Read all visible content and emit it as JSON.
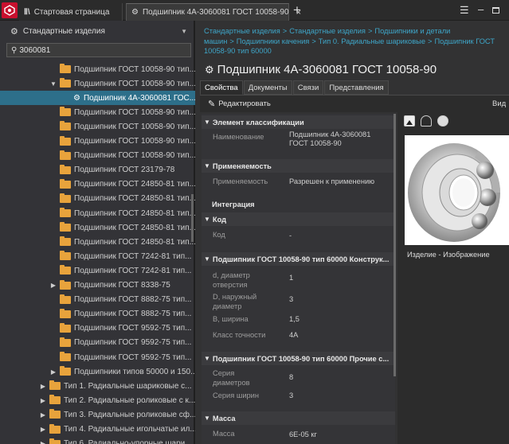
{
  "titlebar": {
    "tab_start": "Стартовая страница",
    "tab_part": "Подшипник 4А-3060081 ГОСТ 10058-90",
    "close_symbol": "×",
    "add_symbol": "+",
    "menu_symbol": "☰",
    "minimize_symbol": "–"
  },
  "left_panel": {
    "title": "Стандартные изделия",
    "search_value": "3060081",
    "tree": [
      {
        "label": "Подшипник ГОСТ 10058-90 тип...",
        "level": 1,
        "folder": true,
        "arrow": ""
      },
      {
        "label": "Подшипник ГОСТ 10058-90 тип...",
        "level": 1,
        "folder": true,
        "arrow": "▼"
      },
      {
        "label": "Подшипник 4А-3060081 ГОС...",
        "level": 2,
        "folder": false,
        "arrow": "",
        "selected": true
      },
      {
        "label": "Подшипник ГОСТ 10058-90 тип...",
        "level": 1,
        "folder": true,
        "arrow": ""
      },
      {
        "label": "Подшипник ГОСТ 10058-90 тип...",
        "level": 1,
        "folder": true,
        "arrow": ""
      },
      {
        "label": "Подшипник ГОСТ 10058-90 тип...",
        "level": 1,
        "folder": true,
        "arrow": ""
      },
      {
        "label": "Подшипник ГОСТ 10058-90 тип...",
        "level": 1,
        "folder": true,
        "arrow": ""
      },
      {
        "label": "Подшипник ГОСТ 23179-78",
        "level": 1,
        "folder": true,
        "arrow": ""
      },
      {
        "label": "Подшипник ГОСТ 24850-81 тип...",
        "level": 1,
        "folder": true,
        "arrow": ""
      },
      {
        "label": "Подшипник ГОСТ 24850-81 тип...",
        "level": 1,
        "folder": true,
        "arrow": ""
      },
      {
        "label": "Подшипник ГОСТ 24850-81 тип...",
        "level": 1,
        "folder": true,
        "arrow": ""
      },
      {
        "label": "Подшипник ГОСТ 24850-81 тип...",
        "level": 1,
        "folder": true,
        "arrow": ""
      },
      {
        "label": "Подшипник ГОСТ 24850-81 тип...",
        "level": 1,
        "folder": true,
        "arrow": ""
      },
      {
        "label": "Подшипник ГОСТ 7242-81 тип...",
        "level": 1,
        "folder": true,
        "arrow": ""
      },
      {
        "label": "Подшипник ГОСТ 7242-81 тип...",
        "level": 1,
        "folder": true,
        "arrow": ""
      },
      {
        "label": "Подшипник ГОСТ 8338-75",
        "level": 1,
        "folder": true,
        "arrow": "▶"
      },
      {
        "label": "Подшипник ГОСТ 8882-75 тип...",
        "level": 1,
        "folder": true,
        "arrow": ""
      },
      {
        "label": "Подшипник ГОСТ 8882-75 тип...",
        "level": 1,
        "folder": true,
        "arrow": ""
      },
      {
        "label": "Подшипник ГОСТ 9592-75 тип...",
        "level": 1,
        "folder": true,
        "arrow": ""
      },
      {
        "label": "Подшипник ГОСТ 9592-75 тип...",
        "level": 1,
        "folder": true,
        "arrow": ""
      },
      {
        "label": "Подшипник ГОСТ 9592-75 тип...",
        "level": 1,
        "folder": true,
        "arrow": ""
      },
      {
        "label": "Подшипники типов 50000 и 150...",
        "level": 1,
        "folder": true,
        "arrow": "▶"
      },
      {
        "label": "Тип 1. Радиальные шариковые с...",
        "level": 0,
        "folder": true,
        "arrow": "▶"
      },
      {
        "label": "Тип 2. Радиальные роликовые с к...",
        "level": 0,
        "folder": true,
        "arrow": "▶"
      },
      {
        "label": "Тип 3. Радиальные роликовые сф...",
        "level": 0,
        "folder": true,
        "arrow": "▶"
      },
      {
        "label": "Тип 4. Радиальные игольчатые ил...",
        "level": 0,
        "folder": true,
        "arrow": "▶"
      },
      {
        "label": "Тип 6. Радиально-упорные шари...",
        "level": 0,
        "folder": true,
        "arrow": "▶"
      }
    ]
  },
  "breadcrumb": {
    "items": [
      "Стандартные изделия",
      "Стандартные изделия",
      "Подшипники и детали машин",
      "Подшипники качения",
      "Тип 0. Радиальные шариковые",
      "Подшипник ГОСТ 10058-90 тип 60000"
    ],
    "separator": ">"
  },
  "part": {
    "title": "Подшипник 4А-3060081 ГОСТ 10058-90"
  },
  "tabs": [
    "Свойства",
    "Документы",
    "Связи",
    "Представления"
  ],
  "toolbar": {
    "edit_label": "Редактировать",
    "view_label": "Вид"
  },
  "properties": {
    "sec_classification": "Элемент классификации",
    "name_label": "Наименование",
    "name_value": "Подшипник 4А-3060081 ГОСТ 10058-90",
    "sec_applicability": "Применяемость",
    "applicability_label": "Применяемость",
    "applicability_value": "Разрешен к применению",
    "integration_label": "Интеграция",
    "sec_code": "Код",
    "code_label": "Код",
    "code_value": "-",
    "sec_design": "Подшипник ГОСТ 10058-90 тип 60000 Конструк...",
    "d_label": "d, диаметр отверстия",
    "d_value": "1",
    "D_label": "D, наружный диаметр",
    "D_value": "3",
    "B_label": "B, ширина",
    "B_value": "1,5",
    "accuracy_label": "Класс точности",
    "accuracy_value": "4А",
    "sec_other": "Подшипник ГОСТ 10058-90 тип 60000 Прочие с...",
    "diam_series_label": "Серия диаметров",
    "diam_series_value": "8",
    "width_series_label": "Серия ширин",
    "width_series_value": "3",
    "sec_mass": "Масса",
    "mass_label": "Масса",
    "mass_value": "6E-05  кг"
  },
  "image_panel": {
    "caption": "Изделие  -  Изображение"
  }
}
